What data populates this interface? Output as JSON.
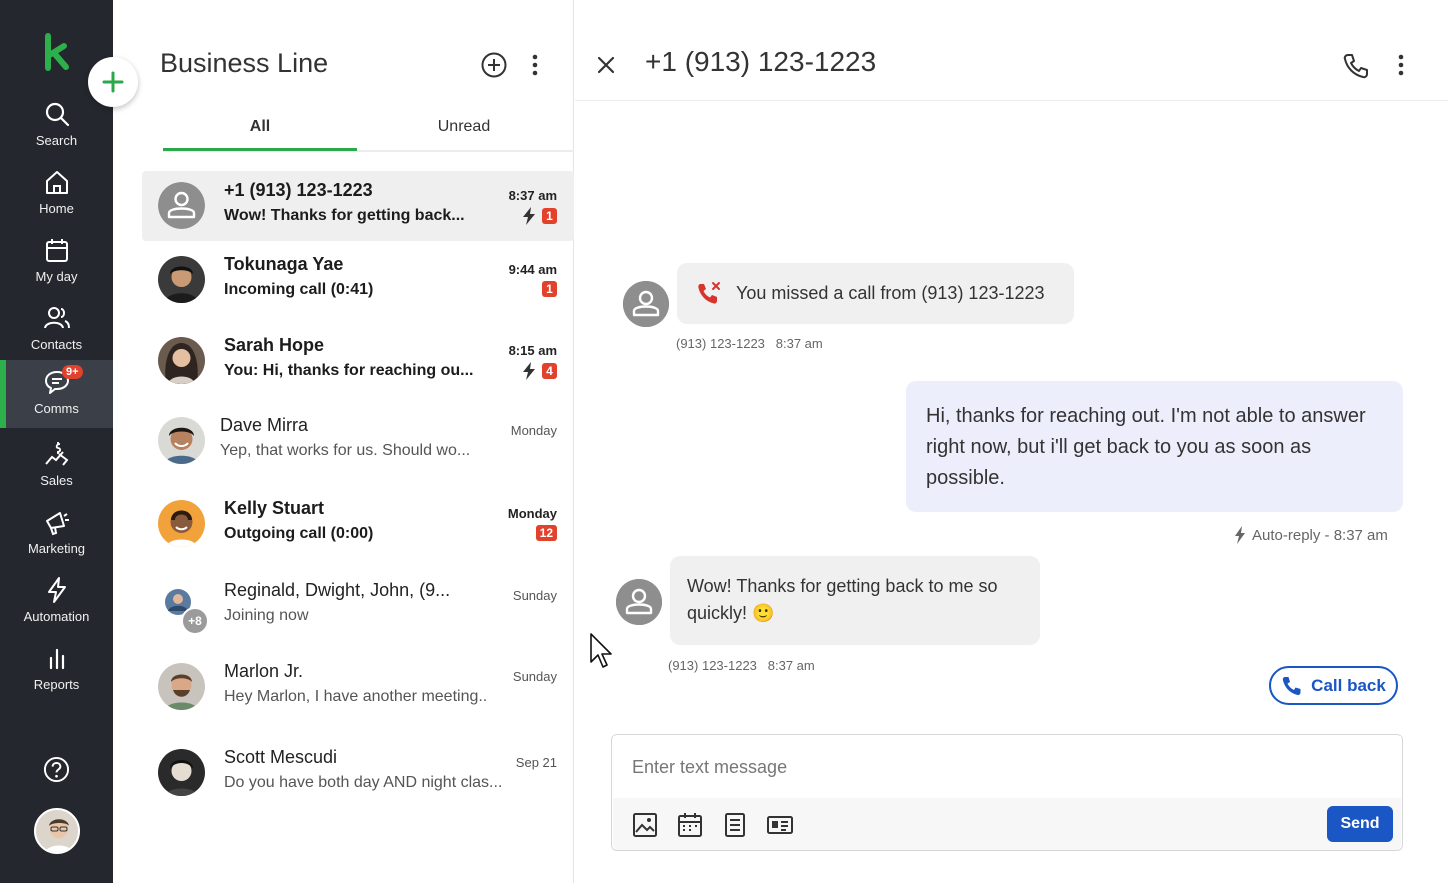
{
  "nav": {
    "items": [
      {
        "label": "Search",
        "icon": "search-icon"
      },
      {
        "label": "Home",
        "icon": "home-icon"
      },
      {
        "label": "My day",
        "icon": "calendar-icon"
      },
      {
        "label": "Contacts",
        "icon": "contacts-icon"
      },
      {
        "label": "Comms",
        "icon": "chat-icon",
        "badge": "9+",
        "active": true
      },
      {
        "label": "Sales",
        "icon": "sales-icon"
      },
      {
        "label": "Marketing",
        "icon": "megaphone-icon"
      },
      {
        "label": "Automation",
        "icon": "lightning-icon"
      },
      {
        "label": "Reports",
        "icon": "bar-chart-icon"
      }
    ]
  },
  "list": {
    "title": "Business Line",
    "tabs": [
      {
        "label": "All",
        "selected": true
      },
      {
        "label": "Unread",
        "selected": false
      }
    ],
    "conversations": [
      {
        "name": "+1 (913) 123-1223",
        "preview": "Wow! Thanks for getting back...",
        "time": "8:37 am",
        "badge": "1",
        "automation": true,
        "unread": true,
        "selected": true,
        "avatar": "generic"
      },
      {
        "name": "Tokunaga Yae",
        "preview": "Incoming call (0:41)",
        "time": "9:44 am",
        "badge": "1",
        "automation": false,
        "unread": true,
        "avatar": "photo"
      },
      {
        "name": "Sarah Hope",
        "preview": "You: Hi, thanks for reaching ou...",
        "time": "8:15 am",
        "badge": "4",
        "automation": true,
        "unread": true,
        "avatar": "photo"
      },
      {
        "name": "Dave Mirra",
        "preview": "Yep, that works for us. Should wo...",
        "time": "Monday",
        "unread": false,
        "avatar": "photo"
      },
      {
        "name": "Kelly Stuart",
        "preview": "Outgoing call (0:00)",
        "time": "Monday",
        "badge": "12",
        "automation": false,
        "unread": true,
        "avatar": "photo"
      },
      {
        "name": "Reginald, Dwight, John, (9...",
        "preview": "Joining now",
        "time": "Sunday",
        "unread": false,
        "avatar": "group",
        "group_extra": "+8"
      },
      {
        "name": "Marlon Jr.",
        "preview": "Hey Marlon, I have another meeting..",
        "time": "Sunday",
        "unread": false,
        "avatar": "photo"
      },
      {
        "name": "Scott Mescudi",
        "preview": "Do you have both day AND night clas...",
        "time": "Sep 21",
        "unread": false,
        "avatar": "photo"
      }
    ]
  },
  "conversation": {
    "title": "+1 (913) 123-1223",
    "missed_call": {
      "text": "You missed a call from (913) 123-1223",
      "sender": "(913) 123-1223",
      "time": "8:37 am"
    },
    "auto_reply": {
      "text": "Hi, thanks for reaching out. I'm not able to answer right now, but i'll get back to you as soon as possible.",
      "meta": "Auto-reply - 8:37 am"
    },
    "incoming": {
      "text": "Wow! Thanks for getting back to me so quickly! 🙂",
      "sender": "(913) 123-1223",
      "time": "8:37 am"
    },
    "call_back_label": "Call back",
    "composer": {
      "placeholder": "Enter text message",
      "send_label": "Send"
    }
  },
  "colors": {
    "nav_bg": "#24282e",
    "accent_green": "#2aa84a",
    "primary_blue": "#1a56c4",
    "badge_red": "#e2412b"
  }
}
